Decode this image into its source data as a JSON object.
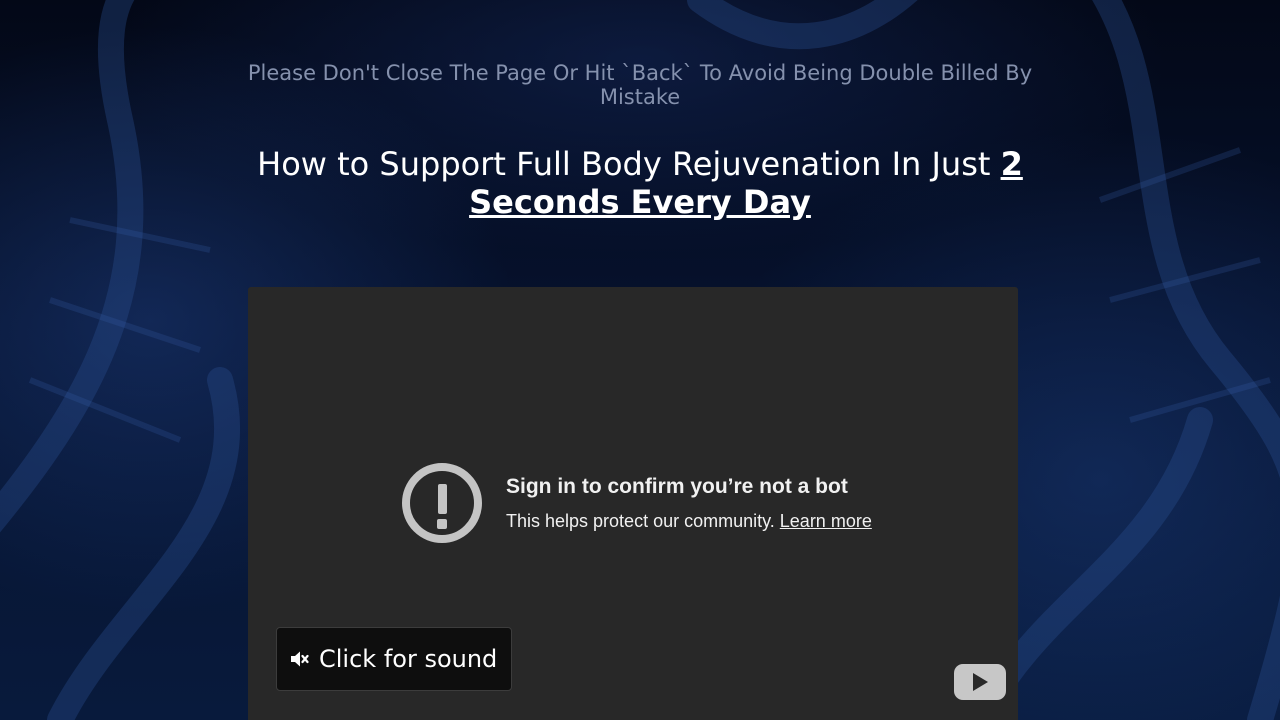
{
  "page": {
    "warning": "Please Don't Close The Page Or Hit `Back` To Avoid Being Double Billed By Mistake",
    "headline_plain": "How to Support Full Body Rejuvenation In Just ",
    "headline_emphasis": "2 Seconds Every Day"
  },
  "video": {
    "notice_title": "Sign in to confirm you’re not a bot",
    "notice_text": "This helps protect our community. ",
    "learn_more": "Learn more",
    "sound_button": "Click for sound",
    "icons": [
      "alert-icon",
      "muted-speaker-icon",
      "youtube-logo-icon"
    ]
  },
  "colors": {
    "background": "#040a1c",
    "player": "#282828",
    "warning_text": "#8591ad",
    "headline_text": "#ffffff"
  }
}
